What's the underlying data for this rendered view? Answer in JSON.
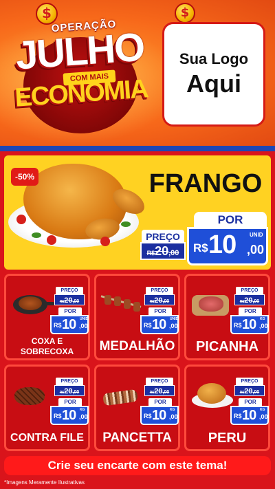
{
  "header": {
    "campaign_top": "OPERAÇÃO",
    "campaign_main": "JULHO",
    "campaign_badge": "COM MAIS",
    "campaign_bottom": "ECONOMIA",
    "currency_badge": "$",
    "logo_line1": "Sua Logo",
    "logo_line2": "Aqui"
  },
  "featured": {
    "discount": "-50%",
    "name": "FRANGO",
    "preco_label": "PREÇO",
    "por_label": "POR",
    "old_currency": "R$",
    "old_int": "20",
    "old_dec": ",00",
    "new_currency": "R$",
    "new_int": "10",
    "new_dec": ",00",
    "unit": "UNID"
  },
  "products": [
    {
      "name_line1": "COXA E",
      "name_line2": "SOBRECOXA",
      "preco_label": "PREÇO",
      "por_label": "POR",
      "old_currency": "R$",
      "old_int": "20",
      "old_dec": ",00",
      "new_currency": "R$",
      "new_int": "10",
      "new_dec": ",00",
      "unit": "UNID"
    },
    {
      "name_line1": "MEDALHÃO",
      "preco_label": "PREÇO",
      "por_label": "POR",
      "old_currency": "R$",
      "old_int": "20",
      "old_dec": ",00",
      "new_currency": "R$",
      "new_int": "10",
      "new_dec": ",00",
      "unit": "UNID"
    },
    {
      "name_line1": "PICANHA",
      "preco_label": "PREÇO",
      "por_label": "POR",
      "old_currency": "R$",
      "old_int": "20",
      "old_dec": ",00",
      "new_currency": "R$",
      "new_int": "10",
      "new_dec": ",00",
      "unit": "KG"
    },
    {
      "name_line1": "CONTRA FILE",
      "preco_label": "PREÇO",
      "por_label": "POR",
      "old_currency": "R$",
      "old_int": "20",
      "old_dec": ",00",
      "new_currency": "R$",
      "new_int": "10",
      "new_dec": ",00",
      "unit": "KG"
    },
    {
      "name_line1": "PANCETTA",
      "preco_label": "PREÇO",
      "por_label": "POR",
      "old_currency": "R$",
      "old_int": "20",
      "old_dec": ",00",
      "new_currency": "R$",
      "new_int": "10",
      "new_dec": ",00",
      "unit": "KG"
    },
    {
      "name_line1": "PERU",
      "preco_label": "PREÇO",
      "por_label": "POR",
      "old_currency": "R$",
      "old_int": "20",
      "old_dec": ",00",
      "new_currency": "R$",
      "new_int": "10",
      "new_dec": ",00",
      "unit": "KG"
    }
  ],
  "footer": {
    "cta": "Crie seu encarte com este tema!",
    "disclaimer": "*Imagens Meramente Ilustrativas"
  },
  "colors": {
    "header_orange": "#f7681a",
    "brand_red": "#d9141b",
    "price_blue": "#1f4fd8",
    "featured_yellow": "#ffd222"
  },
  "icons": [
    "dollar-coin-icon"
  ]
}
